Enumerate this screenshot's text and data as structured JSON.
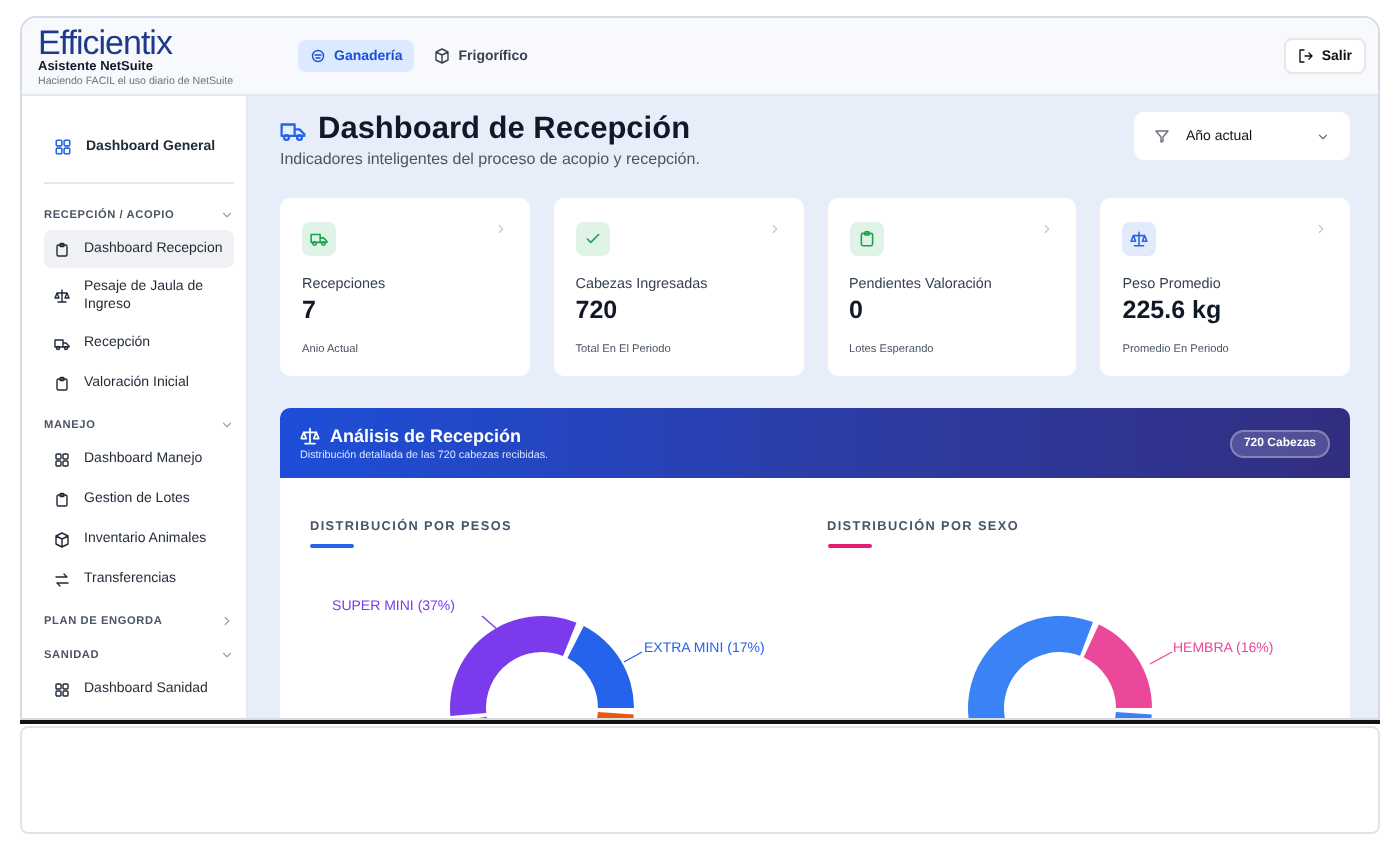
{
  "brand": {
    "logo": "Efficientix",
    "title": "Asistente NetSuite",
    "tagline": "Haciendo FACIL el uso diario de NetSuite"
  },
  "top_tabs": [
    {
      "label": "Ganadería",
      "selected": true
    },
    {
      "label": "Frigorífico",
      "selected": false
    }
  ],
  "logout_button": "Salir",
  "sidebar": {
    "home": {
      "label": "Dashboard General",
      "selected": false
    },
    "sections": [
      {
        "title": "RECEPCIÓN / ACOPIO",
        "expanded": true,
        "items": [
          {
            "label": "Dashboard Recepcion",
            "selected": true
          },
          {
            "label": "Pesaje de Jaula de Ingreso",
            "selected": false
          },
          {
            "label": "Recepción",
            "selected": false
          },
          {
            "label": "Valoración Inicial",
            "selected": false
          }
        ]
      },
      {
        "title": "MANEJO",
        "expanded": true,
        "items": [
          {
            "label": "Dashboard Manejo",
            "selected": false
          },
          {
            "label": "Gestion de Lotes",
            "selected": false
          },
          {
            "label": "Inventario Animales",
            "selected": false
          },
          {
            "label": "Transferencias",
            "selected": false
          }
        ]
      },
      {
        "title": "PLAN DE ENGORDA",
        "expanded": false
      },
      {
        "title": "SANIDAD",
        "expanded": true,
        "items": [
          {
            "label": "Dashboard Sanidad",
            "selected": false
          }
        ]
      }
    ]
  },
  "page": {
    "title": "Dashboard de Recepción",
    "subtitle": "Indicadores inteligentes del proceso de acopio y recepción.",
    "filter": "Año actual"
  },
  "kpis": [
    {
      "label": "Recepciones",
      "value": "7",
      "note": "Anio Actual",
      "color": "#16a34a"
    },
    {
      "label": "Cabezas Ingresadas",
      "value": "720",
      "note": "Total En El Periodo",
      "color": "#16a34a"
    },
    {
      "label": "Pendientes Valoración",
      "value": "0",
      "note": "Lotes Esperando",
      "color": "#16a34a"
    },
    {
      "label": "Peso Promedio",
      "value": "225.6 kg",
      "note": "Promedio En Periodo",
      "color": "#2563eb"
    }
  ],
  "analysis": {
    "title": "Análisis de Recepción",
    "subtitle": "Distribución detallada de las 720 cabezas recibidas.",
    "badge": "720 Cabezas",
    "panels": [
      {
        "title": "DISTRIBUCIÓN POR PESOS",
        "color": "#2563eb",
        "labels": [
          {
            "text": "SUPER MINI (37%)",
            "color": "#7c3aed"
          },
          {
            "text": "EXTRA MINI (17%)",
            "color": "#2563eb"
          }
        ]
      },
      {
        "title": "DISTRIBUCIÓN POR SEXO",
        "color": "#e11d74",
        "labels": [
          {
            "text": "HEMBRA (16%)",
            "color": "#ec4899"
          }
        ]
      }
    ]
  }
}
